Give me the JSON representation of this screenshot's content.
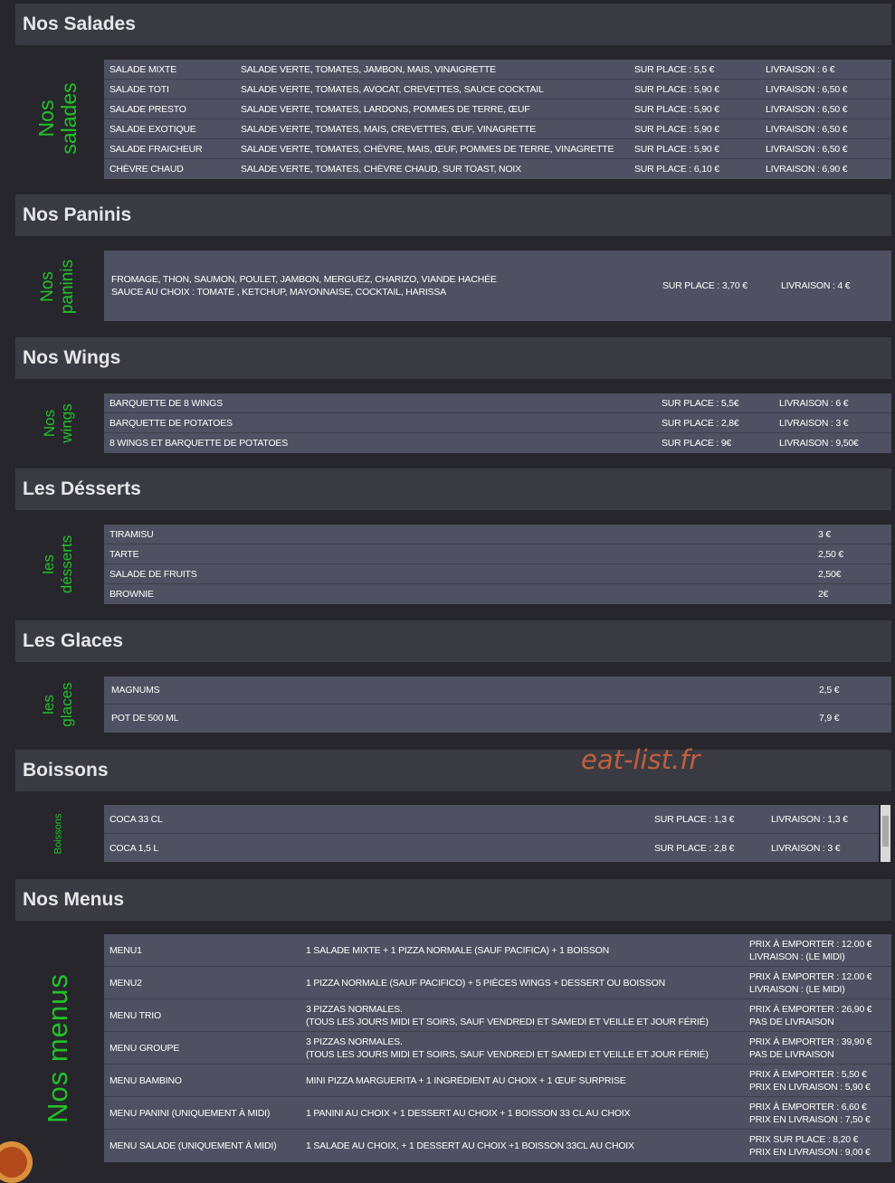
{
  "watermark": "eat-list.fr",
  "salades": {
    "header": "Nos Salades",
    "label": "Nos salades",
    "rows": [
      {
        "name": "SALADE MIXTE",
        "desc": "SALADE VERTE, TOMATES, JAMBON, MAIS, VINAIGRETTE",
        "place": "SUR PLACE : 5,5 €",
        "livraison": "LIVRAISON : 6 €"
      },
      {
        "name": "SALADE TOTI",
        "desc": "SALADE VERTE, TOMATES, AVOCAT, CREVETTES, SAUCE COCKTAIL",
        "place": "SUR PLACE : 5,90 €",
        "livraison": "LIVRAISON : 6,50 €"
      },
      {
        "name": "SALADE PRESTO",
        "desc": "SALADE VERTE, TOMATES, LARDONS, POMMES DE TERRE, ŒUF",
        "place": "SUR PLACE : 5,90 €",
        "livraison": "LIVRAISON : 6,50 €"
      },
      {
        "name": "SALADE EXOTIQUE",
        "desc": "SALADE VERTE, TOMATES, MAIS, CREVETTES, ŒUF, VINAGRETTE",
        "place": "SUR PLACE : 5,90 €",
        "livraison": "LIVRAISON : 6,50 €"
      },
      {
        "name": "SALADE FRAICHEUR",
        "desc": "SALADE VERTE, TOMATES, CHÈVRE, MAIS, ŒUF, POMMES DE TERRE, VINAGRETTE",
        "place": "SUR PLACE : 5,90 €",
        "livraison": "LIVRAISON : 6,50 €"
      },
      {
        "name": "CHÈVRE CHAUD",
        "desc": "SALADE VERTE, TOMATES, CHÈVRE CHAUD, SUR TOAST, NOIX",
        "place": "SUR PLACE : 6,10 €",
        "livraison": "LIVRAISON : 6,90 €"
      }
    ]
  },
  "paninis": {
    "header": "Nos Paninis",
    "label": "Nos paninis",
    "line1": "FROMAGE, THON, SAUMON, POULET, JAMBON, MERGUEZ, CHARIZO, VIANDE HACHÉE",
    "line2": "SAUCE AU CHOIX : TOMATE , KETCHUP, MAYONNAISE, COCKTAIL, HARISSA",
    "place": "SUR PLACE : 3,70 €",
    "livraison": "LIVRAISON : 4 €"
  },
  "wings": {
    "header": "Nos Wings",
    "label": "Nos wings",
    "rows": [
      {
        "name": "BARQUETTE DE 8 WINGS",
        "place": "SUR PLACE : 5,5€",
        "livraison": "LIVRAISON : 6 €"
      },
      {
        "name": "BARQUETTE DE POTATOES",
        "place": "SUR PLACE : 2,8€",
        "livraison": "LIVRAISON : 3 €"
      },
      {
        "name": "8 WINGS ET BARQUETTE DE POTATOES",
        "place": "SUR PLACE : 9€",
        "livraison": "LIVRAISON : 9,50€"
      }
    ]
  },
  "desserts": {
    "header": "Les Désserts",
    "label": "les désserts",
    "rows": [
      {
        "name": "TIRAMISU",
        "price": "3 €"
      },
      {
        "name": "TARTE",
        "price": "2,50 €"
      },
      {
        "name": "SALADE DE FRUITS",
        "price": "2,50€"
      },
      {
        "name": "BROWNIE",
        "price": "2€"
      }
    ]
  },
  "glaces": {
    "header": "Les Glaces",
    "label": "les glaces",
    "rows": [
      {
        "name": "MAGNUMS",
        "price": "2,5 €"
      },
      {
        "name": "POT DE 500 ML",
        "price": "7,9 €"
      }
    ]
  },
  "boissons": {
    "header": "Boissons",
    "label": "Boissons",
    "rows": [
      {
        "name": "COCA 33 CL",
        "place": "SUR PLACE : 1,3 €",
        "livraison": "LIVRAISON : 1,3 €"
      },
      {
        "name": "COCA 1,5 L",
        "place": "SUR PLACE : 2,8 €",
        "livraison": "LIVRAISON : 3 €"
      }
    ]
  },
  "menus": {
    "header": "Nos Menus",
    "label": "Nos menus",
    "rows": [
      {
        "name": "MENU1",
        "desc1": "1 SALADE MIXTE + 1 PIZZA NORMALE (SAUF PACIFICA) + 1 BOISSON",
        "desc2": "",
        "price1": "PRIX À EMPORTER : 12.00 €",
        "price2": "LIVRAISON : (LE MIDI)"
      },
      {
        "name": "MENU2",
        "desc1": "1 PIZZA NORMALE (SAUF PACIFICO) + 5 PIÈCES WINGS + DESSERT OU BOISSON",
        "desc2": "",
        "price1": "PRIX À EMPORTER : 12.00 €",
        "price2": "LIVRAISON : (LE MIDI)"
      },
      {
        "name": "MENU TRIO",
        "desc1": "3 PIZZAS NORMALES.",
        "desc2": "(TOUS LES JOURS MIDI ET SOIRS, SAUF VENDREDI ET SAMEDI ET VEILLE ET JOUR FÉRIÉ)",
        "price1": "PRIX À EMPORTER : 26,90 €",
        "price2": "PAS DE LIVRAISON"
      },
      {
        "name": "MENU GROUPE",
        "desc1": "3 PIZZAS NORMALES.",
        "desc2": "(TOUS LES JOURS MIDI ET SOIRS, SAUF VENDREDI ET SAMEDI ET VEILLE ET JOUR FÉRIÉ)",
        "price1": "PRIX À EMPORTER : 39,90 €",
        "price2": "PAS DE LIVRAISON"
      },
      {
        "name": "MENU BAMBINO",
        "desc1": "MINI PIZZA MARGUERITA + 1 INGRÉDIENT AU CHOIX + 1 ŒUF SURPRISE",
        "desc2": "",
        "price1": "PRIX À EMPORTER : 5,50 €",
        "price2": "PRIX EN LIVRAISON : 5,90 €"
      },
      {
        "name": "MENU PANINI (UNIQUEMENT À MIDI)",
        "desc1": "1 PANINI AU CHOIX + 1 DESSERT AU CHOIX + 1 BOISSON 33 CL AU CHOIX",
        "desc2": "",
        "price1": "PRIX À EMPORTER : 6,60 €",
        "price2": "PRIX EN LIVRAISON : 7,50 €"
      },
      {
        "name": "MENU SALADE (UNIQUEMENT À MIDI)",
        "desc1": "1 SALADE AU CHOIX, + 1 DESSERT AU CHOIX +1 BOISSON 33CL AU CHOIX",
        "desc2": "",
        "price1": "PRIX SUR PLACE : 8,20 €",
        "price2": "PRIX EN LIVRAISON : 9,00 €"
      }
    ]
  },
  "colors": {
    "background": "#26262c",
    "header": "#3a3a42",
    "panel": "#4f5162",
    "label_green": "#22c229",
    "watermark": "#d0643c"
  }
}
